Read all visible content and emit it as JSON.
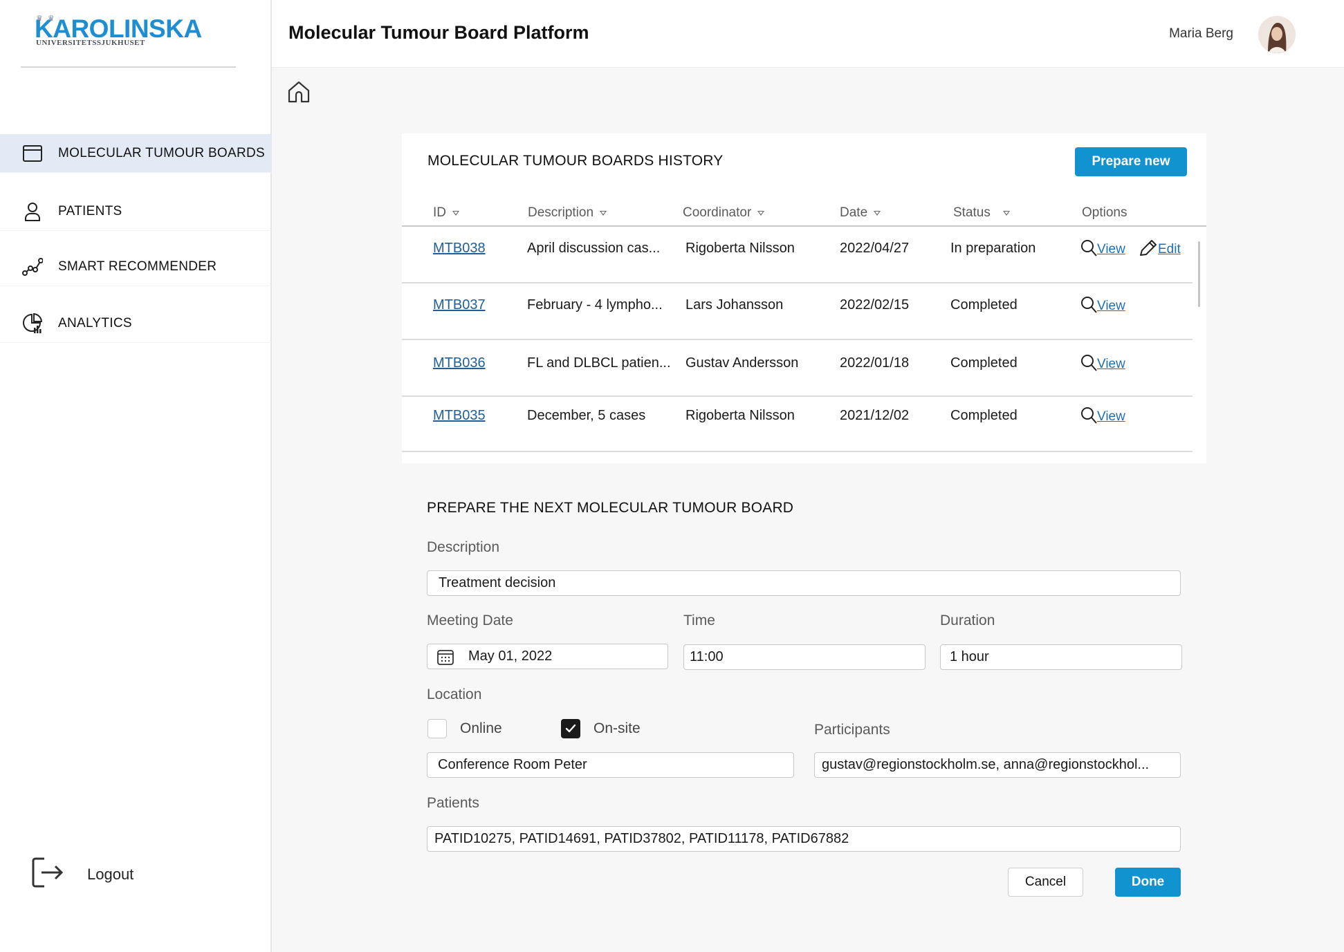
{
  "brand": {
    "name": "KAROLINSKA",
    "subtitle": "UNIVERSITETSSJUKHUSET",
    "color": "#1d8ed1"
  },
  "header": {
    "title": "Molecular Tumour Board Platform",
    "user_name": "Maria Berg"
  },
  "sidebar": {
    "items": [
      {
        "label": "MOLECULAR TUMOUR BOARDS",
        "icon": "calendar-icon",
        "active": true
      },
      {
        "label": "PATIENTS",
        "icon": "person-icon",
        "active": false
      },
      {
        "label": "SMART RECOMMENDER",
        "icon": "graph-nodes-icon",
        "active": false
      },
      {
        "label": "ANALYTICS",
        "icon": "pie-chart-icon",
        "active": false
      }
    ],
    "logout_label": "Logout"
  },
  "history": {
    "title": "MOLECULAR TUMOUR BOARDS HISTORY",
    "prepare_button": "Prepare new",
    "columns": {
      "id": "ID",
      "description": "Description",
      "coordinator": "Coordinator",
      "date": "Date",
      "status": "Status",
      "options": "Options"
    },
    "rows": [
      {
        "id": "MTB038",
        "description": "April discussion cas...",
        "coordinator": "Rigoberta Nilsson",
        "date": "2022/04/27",
        "status": "In preparation",
        "view": "View",
        "edit": "Edit"
      },
      {
        "id": "MTB037",
        "description": "February - 4 lympho...",
        "coordinator": "Lars Johansson",
        "date": "2022/02/15",
        "status": "Completed",
        "view": "View"
      },
      {
        "id": "MTB036",
        "description": "FL and DLBCL patien...",
        "coordinator": "Gustav Andersson",
        "date": "2022/01/18",
        "status": "Completed",
        "view": "View"
      },
      {
        "id": "MTB035",
        "description": "December, 5 cases",
        "coordinator": "Rigoberta Nilsson",
        "date": "2021/12/02",
        "status": "Completed",
        "view": "View"
      }
    ]
  },
  "form": {
    "title": "PREPARE THE NEXT MOLECULAR TUMOUR BOARD",
    "description_label": "Description",
    "description_value": "Treatment decision",
    "meeting_date_label": "Meeting Date",
    "meeting_date_value": "May 01, 2022",
    "time_label": "Time",
    "time_value": "11:00",
    "duration_label": "Duration",
    "duration_value": "1 hour",
    "location_label": "Location",
    "online_label": "Online",
    "online_checked": false,
    "onsite_label": "On-site",
    "onsite_checked": true,
    "location_value": "Conference Room Peter",
    "participants_label": "Participants",
    "participants_value": "gustav@regionstockholm.se, anna@regionstockhol...",
    "patients_label": "Patients",
    "patients_value": "PATID10275, PATID14691, PATID37802, PATID11178, PATID67882",
    "cancel_button": "Cancel",
    "done_button": "Done"
  },
  "colors": {
    "primary": "#1193d0",
    "link": "#1f6fb0",
    "active_nav": "#e3eaf6"
  }
}
